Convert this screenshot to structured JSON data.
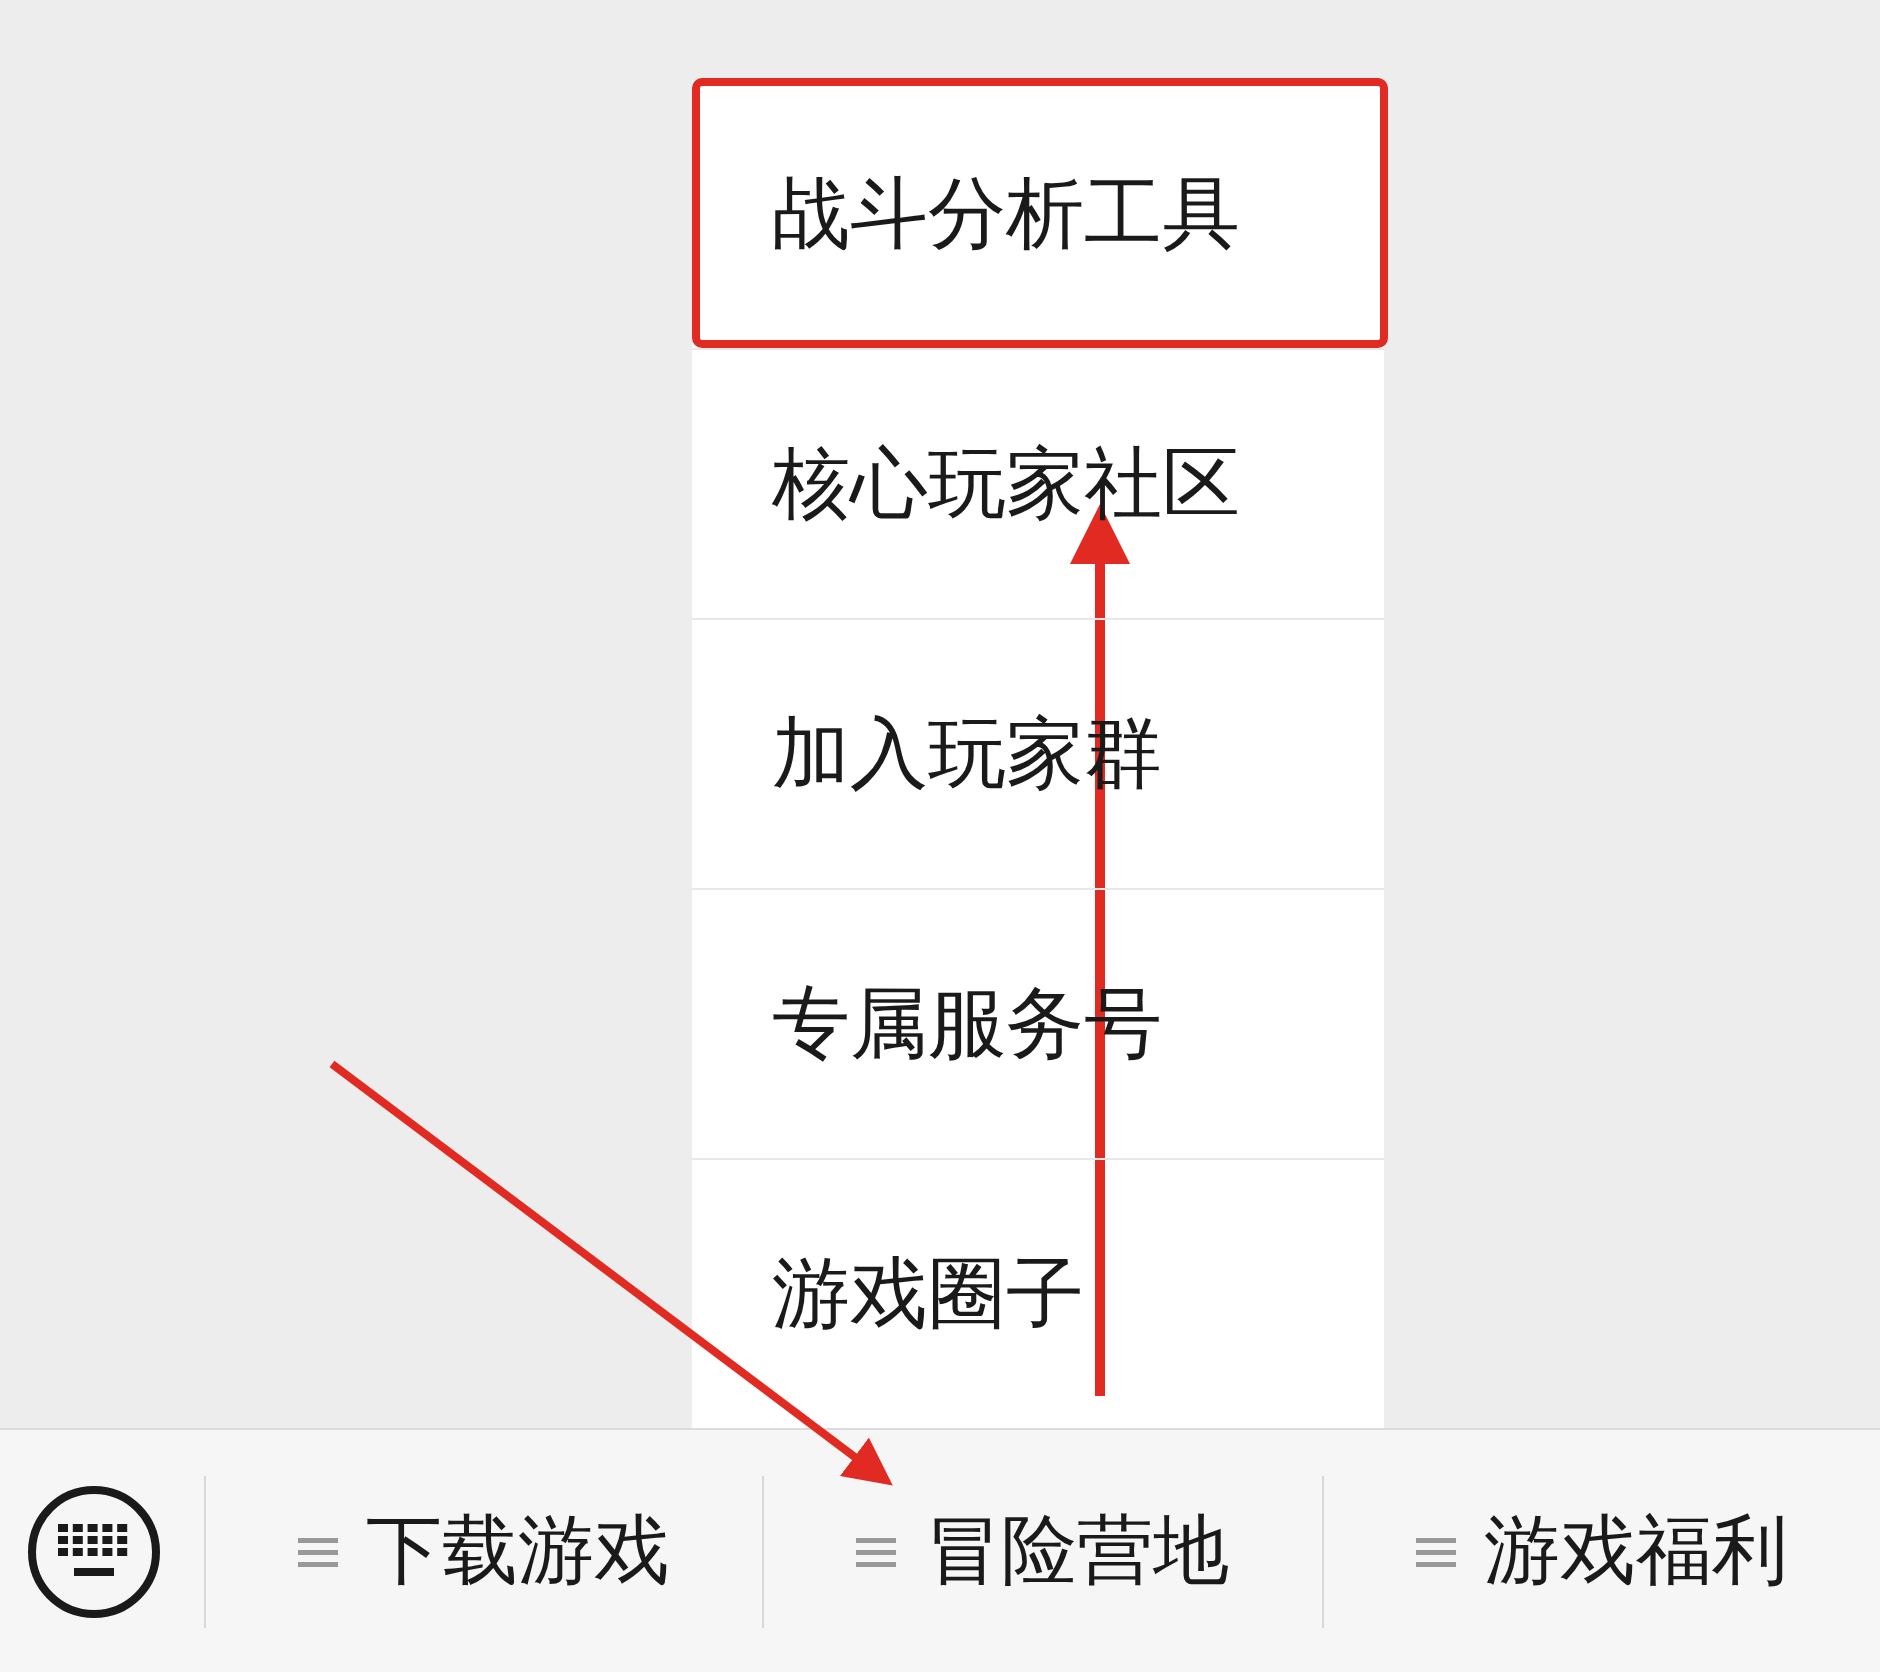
{
  "submenu": {
    "items": [
      {
        "label": "战斗分析工具",
        "highlighted": true
      },
      {
        "label": "核心玩家社区",
        "highlighted": false
      },
      {
        "label": "加入玩家群",
        "highlighted": false
      },
      {
        "label": "专属服务号",
        "highlighted": false
      },
      {
        "label": "游戏圈子",
        "highlighted": false
      }
    ]
  },
  "menu_bar": {
    "tabs": [
      {
        "label": "下载游戏"
      },
      {
        "label": "冒险营地"
      },
      {
        "label": "游戏福利"
      }
    ]
  }
}
